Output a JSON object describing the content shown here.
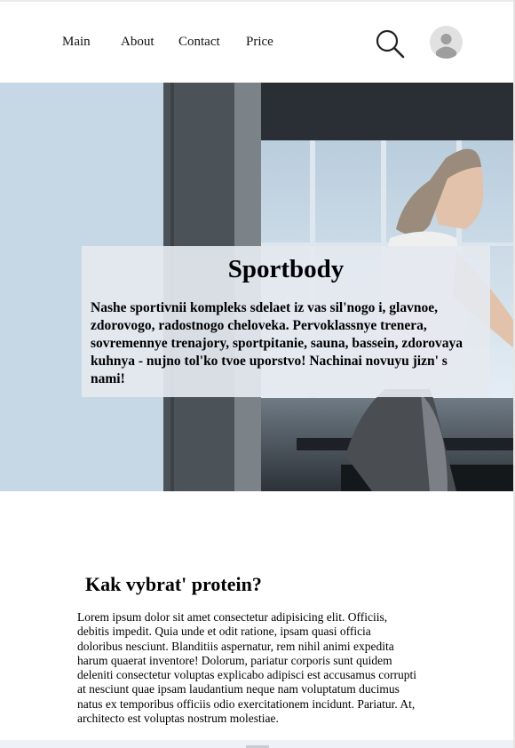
{
  "nav": {
    "items": [
      "Main",
      "About",
      "Contact",
      "Price"
    ]
  },
  "hero": {
    "title": "Sportbody",
    "text": "Nashe sportivnii kompleks sdelaet iz vas sil'nogo i, glavnoe, zdorovogo, radostnogo cheloveka. Pervoklassnye trenera, sovremennye trenajory, sportpitanie, sauna, bassein, zdorovaya kuhnya - nujno tol'ko tvoe uporstvo! Nachinai novuyu jizn' s nami!"
  },
  "section": {
    "title": "Kak vybrat' protein?",
    "body": "Lorem ipsum dolor sit amet consectetur adipisicing elit. Officiis, debitis impedit. Quia unde et odit ratione, ipsam quasi officia doloribus nesciunt. Blanditiis aspernatur, rem nihil animi expedita harum quaerat inventore! Dolorum, pariatur corporis sunt quidem deleniti consectetur voluptas explicabo adipisci est accusamus corrupti at nesciunt quae ipsam laudantium neque nam voluptatum ducimus natus ex temporibus officiis odio exercitationem incidunt. Pariatur. At, architecto est voluptas nostrum molestiae."
  },
  "icons": {
    "search": "search-icon",
    "avatar": "user-avatar-icon"
  },
  "colors": {
    "hero_side_panel": "#c6d8e5",
    "hero_card": "#e5e9f0",
    "avatar_bg": "#e1e1e1"
  }
}
